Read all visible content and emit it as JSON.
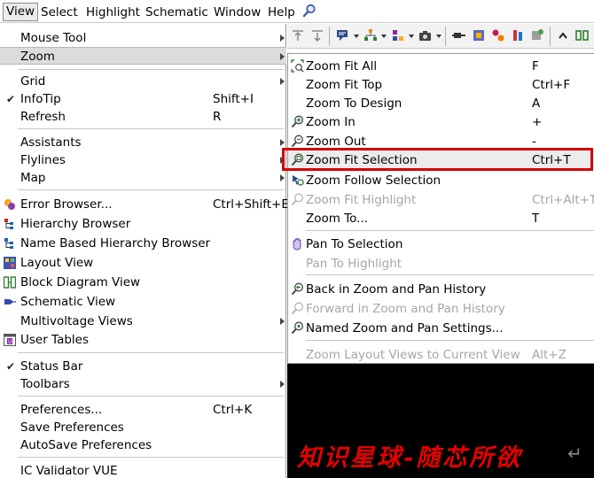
{
  "menubar": {
    "items": [
      "View",
      "Select",
      "Highlight",
      "Schematic",
      "Window",
      "Help"
    ],
    "search_icon": "magnifier-icon"
  },
  "view_menu": {
    "items": [
      {
        "label": "Mouse Tool",
        "shortcut": "",
        "submenu": true
      },
      {
        "label": "Zoom",
        "shortcut": "",
        "submenu": true,
        "highlighted": true
      },
      {
        "label": "Grid",
        "shortcut": "",
        "submenu": true
      },
      {
        "label": "InfoTip",
        "shortcut": "Shift+I",
        "checked": true
      },
      {
        "label": "Refresh",
        "shortcut": "R"
      },
      {
        "label": "Assistants",
        "shortcut": "",
        "submenu": true
      },
      {
        "label": "Flylines",
        "shortcut": "",
        "submenu": true
      },
      {
        "label": "Map",
        "shortcut": "",
        "submenu": true
      },
      {
        "label": "Error Browser...",
        "shortcut": "Ctrl+Shift+E",
        "icon": "error-browser-icon"
      },
      {
        "label": "Hierarchy Browser",
        "shortcut": "",
        "icon": "hierarchy-icon"
      },
      {
        "label": "Name Based Hierarchy Browser",
        "shortcut": "",
        "icon": "name-hierarchy-icon"
      },
      {
        "label": "Layout View",
        "shortcut": "",
        "icon": "layout-view-icon"
      },
      {
        "label": "Block Diagram View",
        "shortcut": "",
        "icon": "block-diagram-icon"
      },
      {
        "label": "Schematic View",
        "shortcut": "",
        "icon": "schematic-view-icon"
      },
      {
        "label": "Multivoltage Views",
        "shortcut": "",
        "submenu": true
      },
      {
        "label": "User Tables",
        "shortcut": "",
        "icon": "user-tables-icon"
      },
      {
        "label": "Status Bar",
        "shortcut": "",
        "checked": true
      },
      {
        "label": "Toolbars",
        "shortcut": "",
        "submenu": true
      },
      {
        "label": "Preferences...",
        "shortcut": "Ctrl+K"
      },
      {
        "label": "Save Preferences",
        "shortcut": ""
      },
      {
        "label": "AutoSave Preferences",
        "shortcut": ""
      },
      {
        "label": "IC Validator VUE",
        "shortcut": ""
      }
    ]
  },
  "zoom_menu": {
    "items": [
      {
        "label": "Zoom Fit All",
        "shortcut": "F",
        "icon": "zoom-fit-all-icon"
      },
      {
        "label": "Zoom Fit Top",
        "shortcut": "Ctrl+F"
      },
      {
        "label": "Zoom To Design",
        "shortcut": "A"
      },
      {
        "label": "Zoom In",
        "shortcut": "+",
        "icon": "zoom-in-icon"
      },
      {
        "label": "Zoom Out",
        "shortcut": "-",
        "icon": "zoom-out-icon"
      },
      {
        "label": "Zoom Fit Selection",
        "shortcut": "Ctrl+T",
        "icon": "zoom-fit-selection-icon",
        "highlighted": true
      },
      {
        "label": "Zoom Follow Selection",
        "shortcut": "",
        "icon": "zoom-follow-icon"
      },
      {
        "label": "Zoom Fit Highlight",
        "shortcut": "Ctrl+Alt+T",
        "icon": "zoom-fit-highlight-icon",
        "disabled": true
      },
      {
        "label": "Zoom To...",
        "shortcut": "T"
      },
      {
        "label": "Pan To Selection",
        "shortcut": "",
        "icon": "pan-icon"
      },
      {
        "label": "Pan To Highlight",
        "shortcut": "",
        "disabled": true
      },
      {
        "label": "Back in Zoom and Pan History",
        "shortcut": "",
        "icon": "back-history-icon"
      },
      {
        "label": "Forward in Zoom and Pan History",
        "shortcut": "",
        "icon": "forward-history-icon",
        "disabled": true
      },
      {
        "label": "Named Zoom and Pan Settings...",
        "shortcut": "",
        "icon": "named-zoom-icon"
      },
      {
        "label": "Zoom Layout Views to Current View",
        "shortcut": "Alt+Z",
        "disabled": true
      }
    ]
  },
  "watermark": "知识星球-随芯所欲",
  "colors": {
    "highlight_box": "#d40000",
    "disabled_text": "#a6a6a6",
    "canvas": "#000000"
  }
}
